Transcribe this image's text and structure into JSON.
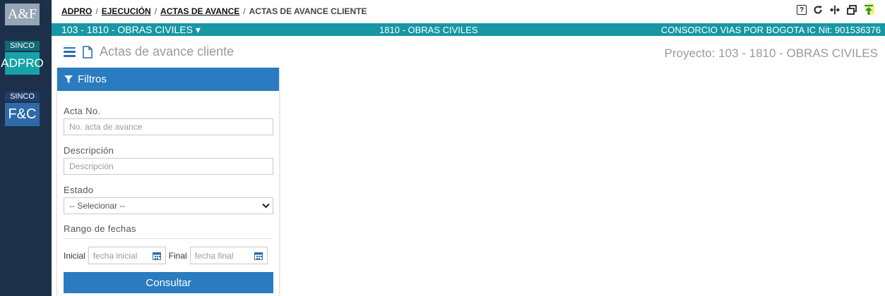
{
  "sidebar": {
    "modules": [
      {
        "label": "A&F"
      },
      {
        "small": "SINCO",
        "big": "ADPRO"
      },
      {
        "small": "SINCO",
        "big": "F&C"
      }
    ]
  },
  "breadcrumb": {
    "items": [
      "ADPRO",
      "EJECUCIÓN",
      "ACTAS DE AVANCE"
    ],
    "current": "ACTAS DE AVANCE CLIENTE",
    "separator": "/"
  },
  "toolbar": {
    "icons": [
      "help-icon",
      "refresh-icon",
      "split-view-icon",
      "window-restore-icon",
      "scroll-top-icon"
    ]
  },
  "project_bar": {
    "selector": "103 - 1810 - OBRAS CIVILES ▾",
    "center": "1810 - OBRAS CIVILES",
    "company": "CONSORCIO VIAS POR BOGOTA IC Nit: 901536376"
  },
  "page": {
    "title": "Actas de avance cliente",
    "project_label": "Proyecto: 103 - 1810 - OBRAS CIVILES"
  },
  "filters": {
    "header": "Filtros",
    "acta_label": "Acta No.",
    "acta_placeholder": "No. acta de avance",
    "descripcion_label": "Descripción",
    "descripcion_placeholder": "Descripción",
    "estado_label": "Estado",
    "estado_selected": "-- Selecionar --",
    "rango_label": "Rango de fechas",
    "inicial_label": "Inicial",
    "inicial_placeholder": "fecha inicial",
    "final_label": "Final",
    "final_placeholder": "fecha final",
    "consultar_label": "Consultar"
  },
  "colors": {
    "sidebar": "#1c3049",
    "project_bar": "#1797a3",
    "primary": "#2a7bbf"
  }
}
